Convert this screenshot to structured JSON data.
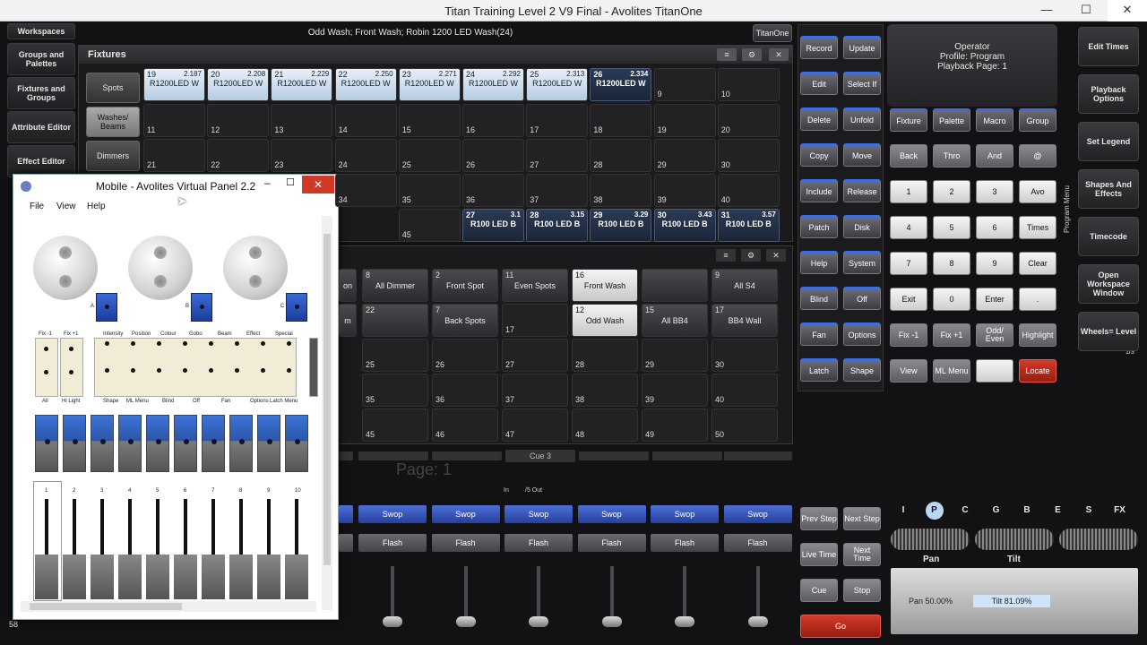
{
  "window": {
    "title": "Titan Training Level 2 V9 Final - Avolites TitanOne",
    "min": "—",
    "max": "☐",
    "close": "✕"
  },
  "status": {
    "text": "Odd Wash; Front Wash; Robin 1200 LED Wash(24)",
    "badge": "TitanOne"
  },
  "left_sidebar": [
    "Workspaces",
    "Groups and Palettes",
    "Fixtures and Groups",
    "Attribute Editor",
    "Effect Editor"
  ],
  "fixtures_panel": {
    "title": "Fixtures",
    "tabs": [
      "Spots",
      "Washes/ Beams",
      "Dimmers"
    ],
    "row1": [
      {
        "n": "19",
        "v": "2.187",
        "l": "R1200LED W"
      },
      {
        "n": "20",
        "v": "2.208",
        "l": "R1200LED W"
      },
      {
        "n": "21",
        "v": "2.229",
        "l": "R1200LED W"
      },
      {
        "n": "22",
        "v": "2.250",
        "l": "R1200LED W"
      },
      {
        "n": "23",
        "v": "2.271",
        "l": "R1200LED W"
      },
      {
        "n": "24",
        "v": "2.292",
        "l": "R1200LED W"
      },
      {
        "n": "25",
        "v": "2.313",
        "l": "R1200LED W"
      },
      {
        "n": "26",
        "v": "2.334",
        "l": "R1200LED W"
      },
      {
        "n": "9"
      },
      {
        "n": "10"
      }
    ],
    "row2": [
      "11",
      "12",
      "13",
      "14",
      "15",
      "16",
      "17",
      "18",
      "19",
      "20"
    ],
    "row3": [
      "21",
      "22",
      "23",
      "24",
      "25",
      "26",
      "27",
      "28",
      "29",
      "30"
    ],
    "row4": [
      "34",
      "35",
      "36",
      "37",
      "38",
      "39",
      "40"
    ],
    "row5_left": [
      "45"
    ],
    "row5": [
      {
        "n": "27",
        "v": "3.1",
        "l": "R100 LED B"
      },
      {
        "n": "28",
        "v": "3.15",
        "l": "R100 LED B"
      },
      {
        "n": "29",
        "v": "3.29",
        "l": "R100 LED B"
      },
      {
        "n": "30",
        "v": "3.43",
        "l": "R100 LED B"
      },
      {
        "n": "31",
        "v": "3.57",
        "l": "R100 LED B"
      }
    ]
  },
  "groups_panel": {
    "row1": [
      {
        "n": "",
        "l": "on"
      },
      {
        "n": "8",
        "l": "All Dimmer"
      },
      {
        "n": "2",
        "l": "Front Spot"
      },
      {
        "n": "11",
        "l": "Even Spots"
      },
      {
        "n": "16",
        "l": "Front Wash"
      },
      {
        "n": "",
        "l": ""
      },
      {
        "n": "9",
        "l": "All S4"
      }
    ],
    "row2": [
      {
        "n": "",
        "l": "m"
      },
      {
        "n": "22",
        "l": ""
      },
      {
        "n": "7",
        "l": "Back Spots"
      },
      {
        "n": "17",
        "l": ""
      },
      {
        "n": "12",
        "l": "Odd Wash"
      },
      {
        "n": "15",
        "l": "All BB4"
      },
      {
        "n": "17",
        "l": "BB4 Wall"
      }
    ],
    "row3": [
      "25",
      "26",
      "27",
      "28",
      "29",
      "30"
    ],
    "row4": [
      "35",
      "36",
      "37",
      "38",
      "39",
      "40"
    ],
    "row5": [
      "45",
      "46",
      "47",
      "48",
      "49",
      "50"
    ]
  },
  "cue_bar": {
    "cue": "Cue 3",
    "page": "Page: 1",
    "in": "In",
    "out": "/5  Out"
  },
  "playbacks": {
    "swop": "Swop",
    "flash": "Flash",
    "count": 6
  },
  "program_buttons": {
    "col1": [
      "Record",
      "Edit",
      "Delete",
      "Copy",
      "Include",
      "Patch",
      "Help",
      "Blind",
      "Fan",
      "Latch"
    ],
    "col2": [
      "Update",
      "Select If",
      "Unfold",
      "Move",
      "Release",
      "Disk",
      "System",
      "Off",
      "Options",
      "Shape"
    ],
    "cue_col1": [
      "Prev Step",
      "Live Time",
      "Cue"
    ],
    "cue_col2": [
      "Next Step",
      "Next Time",
      "Stop"
    ],
    "go": "Go"
  },
  "operator": {
    "line1": "Operator",
    "line2": "Profile: Program",
    "line3": "Playback Page: 1"
  },
  "keypad": {
    "row1": [
      "Fixture",
      "Palette",
      "Macro",
      "Group"
    ],
    "row2": [
      "Back",
      "Thro",
      "And",
      "@"
    ],
    "row3": [
      "1",
      "2",
      "3",
      "Avo"
    ],
    "row4": [
      "4",
      "5",
      "6",
      "Times"
    ],
    "row5": [
      "7",
      "8",
      "9",
      "Clear"
    ],
    "row6": [
      "Exit",
      "0",
      "Enter",
      "."
    ],
    "row7": [
      "Fix -1",
      "Fix +1",
      "Odd/ Even",
      "Highlight"
    ],
    "row8": [
      "View",
      "ML Menu",
      "",
      "Locate"
    ]
  },
  "program_menu_label": "Program Menu",
  "right_sidebar": [
    "Edit Times",
    "Playback Options",
    "Set Legend",
    "Shapes And Effects",
    "Timecode",
    "Open Workspace Window",
    "Wheels= Level"
  ],
  "wheels_page": "1/3",
  "attribute_tabs": [
    "I",
    "P",
    "C",
    "G",
    "B",
    "E",
    "S",
    "FX"
  ],
  "attributes": {
    "pan_label": "Pan",
    "tilt_label": "Tilt",
    "pan_value": "Pan 50.00%",
    "tilt_value": "Tilt 81.09%"
  },
  "left_numbers": [
    "58"
  ],
  "mobile": {
    "title": "Mobile - Avolites Virtual Panel 2.2",
    "menu": [
      "File",
      "View",
      "Help"
    ],
    "wheel_labels": [
      "A",
      "B",
      "C"
    ],
    "attr_labels": [
      "Intensity",
      "Position",
      "Colour",
      "Gobo",
      "Beam",
      "Effect",
      "Special"
    ],
    "fix_labels": [
      "Fix -1",
      "Fix +1"
    ],
    "bottom_labels": [
      "All",
      "Hi Light",
      "Shape",
      "ML Menu",
      "Blind",
      "Off",
      "Fan",
      "Options",
      "Latch Menu"
    ],
    "fader_numbers": [
      "1",
      "2",
      "3",
      "4",
      "5",
      "6",
      "7",
      "8",
      "9",
      "10"
    ]
  }
}
